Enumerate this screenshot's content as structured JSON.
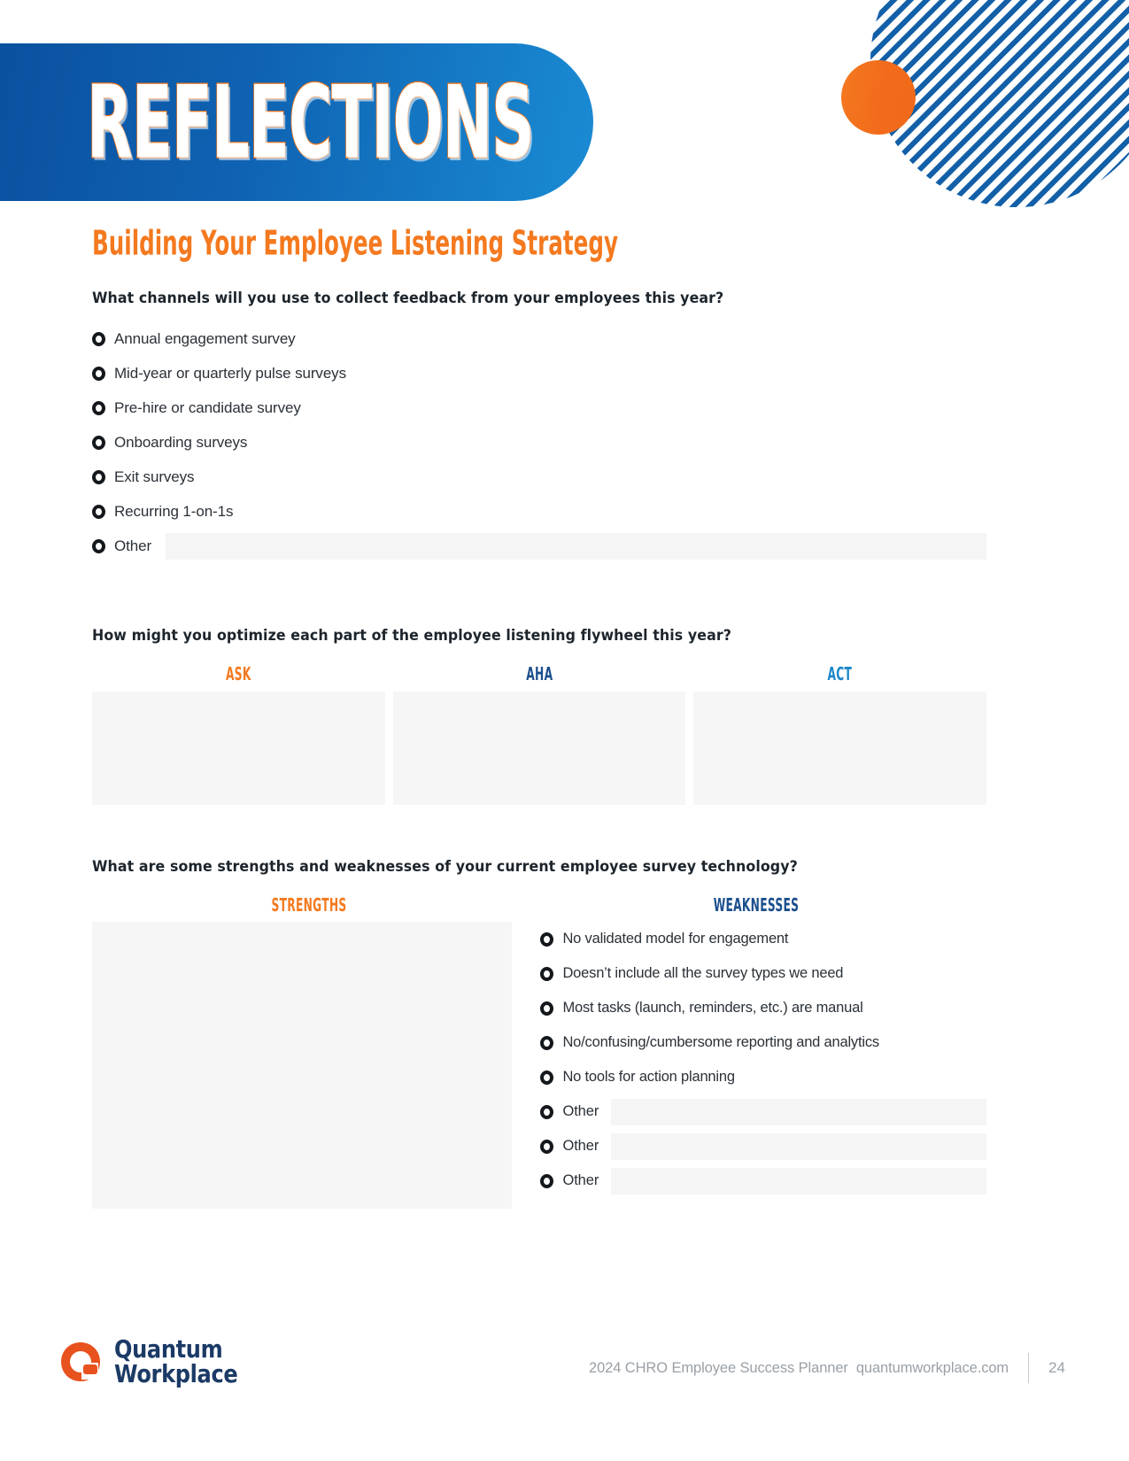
{
  "banner": {
    "title": "REFLECTIONS"
  },
  "page_title": "Building Your Employee Listening Strategy",
  "questions": {
    "channels": "What channels will you use to collect feedback from your employees this year?",
    "flywheel": "How might you optimize each part of the employee listening flywheel this year?",
    "tech": "What are some strengths and weaknesses of your current employee survey technology?"
  },
  "channel_options": [
    "Annual engagement survey",
    "Mid-year or quarterly pulse surveys",
    "Pre-hire or candidate survey",
    "Onboarding surveys",
    "Exit surveys",
    "Recurring 1-on-1s"
  ],
  "other_label": "Other",
  "flywheel_columns": [
    {
      "label": "ASK",
      "color": "#F4791F"
    },
    {
      "label": "AHA",
      "color": "#1B4F8C"
    },
    {
      "label": "ACT",
      "color": "#1C86C8"
    }
  ],
  "strengths": {
    "heading": "STRENGTHS",
    "color": "#F4791F"
  },
  "weaknesses": {
    "heading": "WEAKNESSES",
    "color": "#1B4F8C",
    "options": [
      "No validated model for engagement",
      "Doesn’t include all the survey types we need",
      "Most tasks (launch, reminders, etc.) are manual",
      "No/confusing/cumbersome reporting and analytics",
      "No tools for action planning"
    ],
    "other_rows": [
      "Other",
      "Other",
      "Other"
    ]
  },
  "footer": {
    "logo_line1": "Quantum",
    "logo_line2": "Workplace",
    "text": "2024 CHRO Employee Success Planner",
    "url": "quantumworkplace.com",
    "page_number": "24"
  },
  "colors": {
    "orange": "#F4791F",
    "blue_dark": "#1B4F8C",
    "blue_bright": "#1C86C8",
    "banner_blue_start": "#0A4F9E",
    "banner_blue_end": "#1A8BD4",
    "field_gray": "#F5F5F5",
    "text_dark": "#2B3138"
  }
}
